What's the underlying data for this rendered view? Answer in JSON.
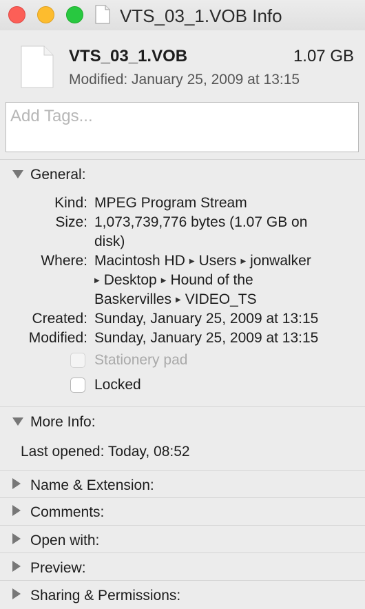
{
  "window": {
    "title": "VTS_03_1.VOB Info"
  },
  "header": {
    "filename": "VTS_03_1.VOB",
    "size": "1.07 GB",
    "modified": "Modified: January 25, 2009 at 13:15"
  },
  "tags": {
    "placeholder": "Add Tags..."
  },
  "general": {
    "title": "General:",
    "kind_label": "Kind:",
    "kind_value": "MPEG Program Stream",
    "size_label": "Size:",
    "size_value_line1": "1,073,739,776 bytes (1.07 GB on",
    "size_value_line2": "disk)",
    "where_label": "Where:",
    "where_path": [
      "Macintosh HD",
      "Users",
      "jonwalker",
      "Desktop",
      "Hound of the",
      "Baskervilles",
      "VIDEO_TS"
    ],
    "created_label": "Created:",
    "created_value": "Sunday, January 25, 2009 at 13:15",
    "modified_label": "Modified:",
    "modified_value": "Sunday, January 25, 2009 at 13:15",
    "stationery_label": "Stationery pad",
    "locked_label": "Locked"
  },
  "more_info": {
    "title": "More Info:",
    "last_opened": "Last opened: Today, 08:52"
  },
  "collapsed_sections": {
    "name_extension": "Name & Extension:",
    "comments": "Comments:",
    "open_with": "Open with:",
    "preview": "Preview:",
    "sharing": "Sharing & Permissions:"
  }
}
